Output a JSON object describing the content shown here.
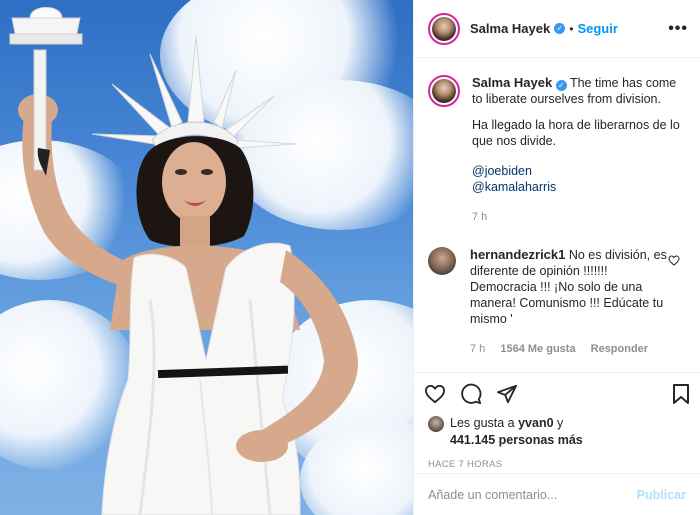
{
  "post": {
    "author": "Salma Hayek",
    "follow_label": "Seguir",
    "dot": "•",
    "more": "•••",
    "caption_lines": [
      "The time has come to liberate ourselves from division."
    ],
    "caption_es": "Ha llegado la hora de liberarnos de lo que nos divide.",
    "mention_1": "@joebiden",
    "mention_2": "@kamalaharris",
    "caption_time": "7 h"
  },
  "comment": {
    "user": "hernandezrick1",
    "text": "No es división, es diferente de opinión !!!!!!! Democracia !!! ¡No solo de una manera! Comunismo !!! Edúcate tu mismo '",
    "time": "7 h",
    "likes": "1564 Me gusta",
    "reply": "Responder"
  },
  "likes": {
    "prefix": "Les gusta a ",
    "user": "yvan0",
    "suffix": " y",
    "count": "441.145 personas más"
  },
  "ago": "HACE 7 HORAS",
  "add_comment": {
    "placeholder": "Añade un comentario...",
    "publish": "Publicar"
  },
  "colors": {
    "accent": "#0095f6",
    "verified": "#3897f0",
    "muted": "#8e8e8e",
    "publish_disabled": "#b2dffc"
  }
}
